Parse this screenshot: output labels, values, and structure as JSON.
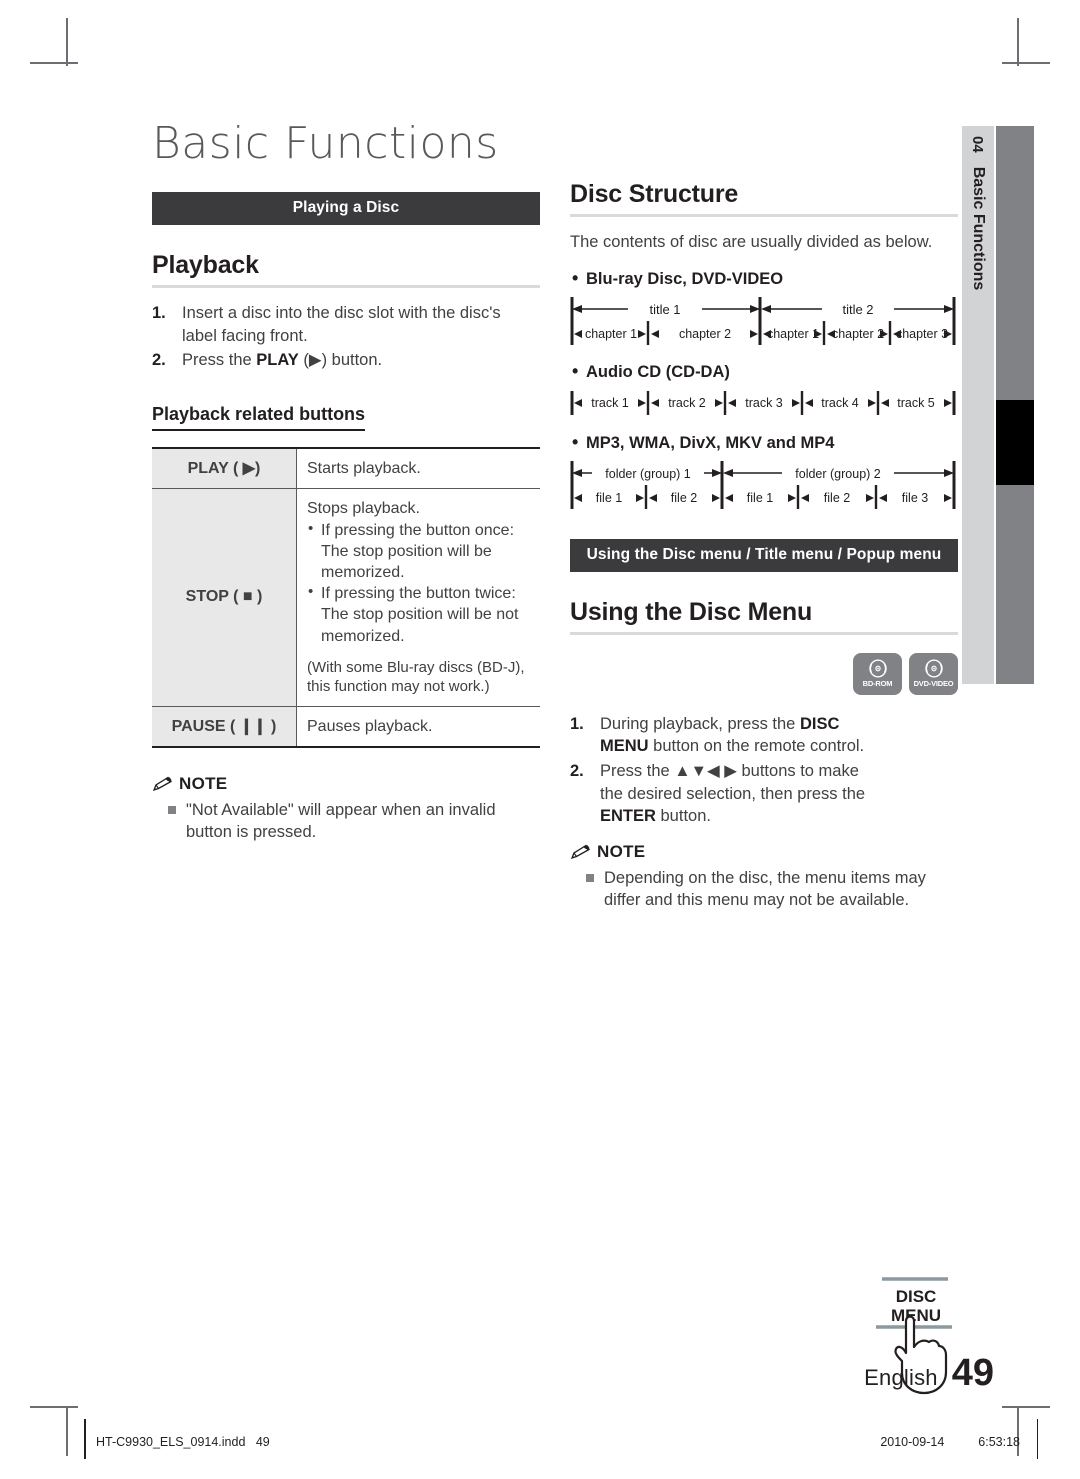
{
  "page": {
    "chapter_number": "04",
    "chapter_name": "Basic Functions",
    "main_title": "Basic Functions",
    "language": "English",
    "page_number": "49"
  },
  "left": {
    "banner": "Playing a Disc",
    "playback_heading": "Playback",
    "steps": [
      {
        "num": "1.",
        "pre": "Insert a disc into the disc slot with the disc's label facing front."
      },
      {
        "num": "2.",
        "pre": "Press the ",
        "bold": "PLAY",
        "post": " (▶) button."
      }
    ],
    "related_heading": "Playback related buttons",
    "table": {
      "rows": [
        {
          "key": "PLAY ( ▶)",
          "lines": [
            "Starts playback."
          ],
          "bullets": [],
          "paren": ""
        },
        {
          "key": "STOP ( ■ )",
          "lines": [
            "Stops playback."
          ],
          "bullets": [
            "If pressing the button once: The stop position will be memorized.",
            "If pressing the button twice: The stop position will be not memorized."
          ],
          "paren": "(With some Blu-ray discs (BD-J), this function may not work.)"
        },
        {
          "key": "PAUSE ( ❙❙ )",
          "lines": [
            "Pauses playback."
          ],
          "bullets": [],
          "paren": ""
        }
      ]
    },
    "note": {
      "title": "NOTE",
      "items": [
        "\"Not Available\" will appear when an invalid button is pressed."
      ]
    }
  },
  "right": {
    "disc_structure_heading": "Disc Structure",
    "disc_structure_intro": "The contents of disc are usually divided as below.",
    "groups": [
      {
        "label": "Blu-ray Disc, DVD-VIDEO",
        "top_row": [
          "title 1",
          "title 2"
        ],
        "bottom_row": [
          "chapter 1",
          "chapter 2",
          "chapter 1",
          "chapter 2",
          "chapter 3"
        ]
      },
      {
        "label": "Audio CD (CD-DA)",
        "top_row": [],
        "bottom_row": [
          "track 1",
          "track 2",
          "track 3",
          "track 4",
          "track 5"
        ]
      },
      {
        "label": "MP3, WMA, DivX, MKV and MP4",
        "top_row": [
          "folder (group) 1",
          "folder (group) 2"
        ],
        "bottom_row": [
          "file 1",
          "file 2",
          "file 1",
          "file 2",
          "file 3"
        ]
      }
    ],
    "banner": "Using the Disc menu / Title menu / Popup menu",
    "disc_menu_heading": "Using the Disc Menu",
    "badges": [
      {
        "label": "BD-ROM",
        "icon": "disc-icon"
      },
      {
        "label": "DVD-VIDEO",
        "icon": "disc-icon"
      }
    ],
    "steps": [
      {
        "num": "1.",
        "pre": "During playback, press the ",
        "bold": "DISC MENU",
        "post": " button on the remote control."
      },
      {
        "num": "2.",
        "pre": "Press the ▲▼◀ ▶ buttons to make the desired selection, then press the ",
        "bold": "ENTER",
        "post": " button."
      }
    ],
    "key_illustration": {
      "line1": "DISC",
      "line2": "MENU"
    },
    "note": {
      "title": "NOTE",
      "items": [
        "Depending on the disc, the menu items may differ and this menu may not be available."
      ]
    }
  },
  "footer": {
    "file_name": "HT-C9930_ELS_0914.indd",
    "file_page": "49",
    "date": "2010-09-14",
    "time": "6:53:18"
  },
  "colors": {
    "banner_bg": "#3b3b3d",
    "tab_bg": "#d2d3d5",
    "bar_gray": "#808285",
    "bar_black": "#000000",
    "rule_gray": "#d9dadb",
    "text": "#231f20"
  }
}
